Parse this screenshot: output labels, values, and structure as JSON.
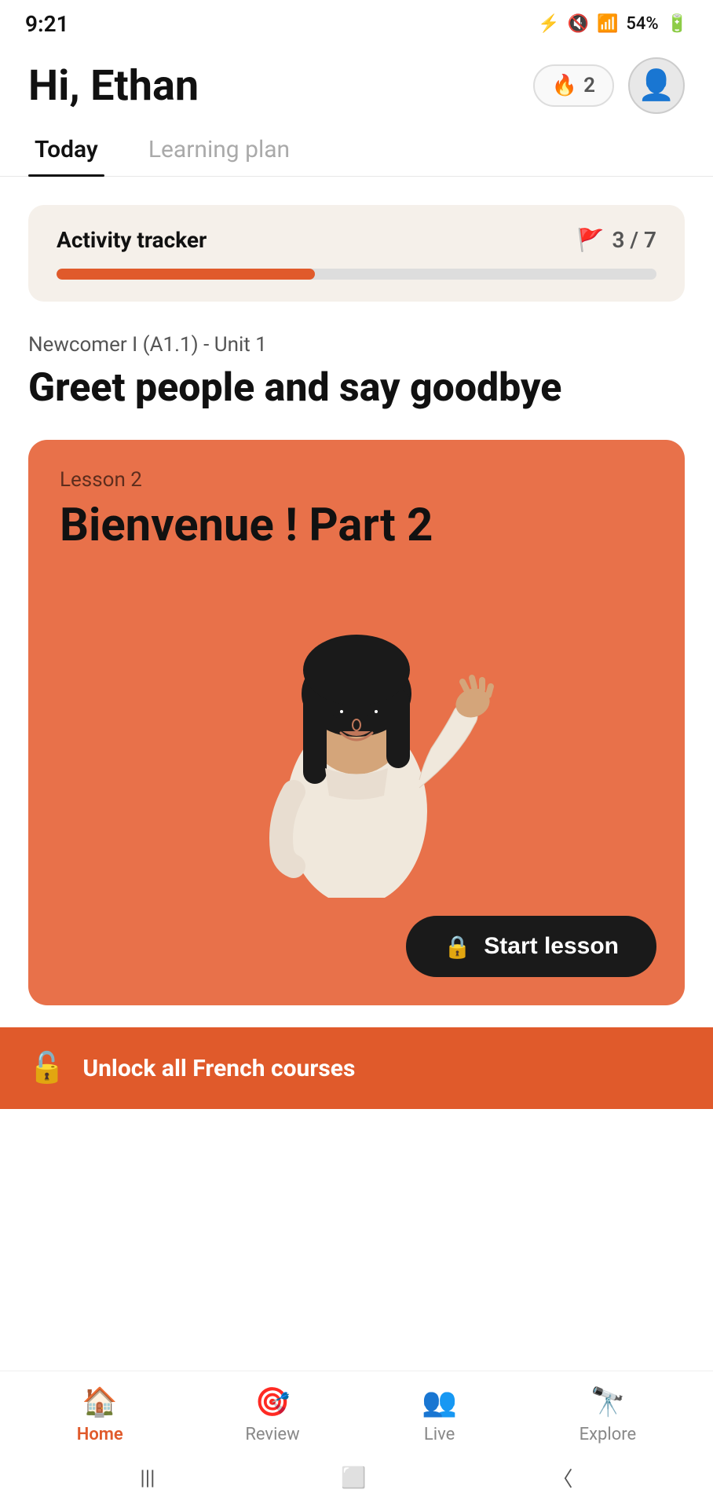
{
  "statusBar": {
    "time": "9:21",
    "batteryPercent": "54%",
    "icons": [
      "bluetooth",
      "mute",
      "wifi",
      "signal",
      "battery"
    ]
  },
  "header": {
    "greeting": "Hi, Ethan",
    "streakCount": "2",
    "streakLabel": "streak"
  },
  "tabs": [
    {
      "id": "today",
      "label": "Today",
      "active": true
    },
    {
      "id": "learning-plan",
      "label": "Learning plan",
      "active": false
    }
  ],
  "activityTracker": {
    "title": "Activity tracker",
    "current": 3,
    "total": 7,
    "progressPercent": 43
  },
  "unit": {
    "label": "Newcomer I (A1.1) - Unit 1",
    "title": "Greet people and say goodbye"
  },
  "lesson": {
    "number": "Lesson 2",
    "title": "Bienvenue ! Part 2",
    "startButtonLabel": "Start lesson"
  },
  "unlockBanner": {
    "text": "Unlock all French courses"
  },
  "bottomNav": [
    {
      "id": "home",
      "label": "Home",
      "active": true
    },
    {
      "id": "review",
      "label": "Review",
      "active": false
    },
    {
      "id": "live",
      "label": "Live",
      "active": false
    },
    {
      "id": "explore",
      "label": "Explore",
      "active": false
    }
  ]
}
